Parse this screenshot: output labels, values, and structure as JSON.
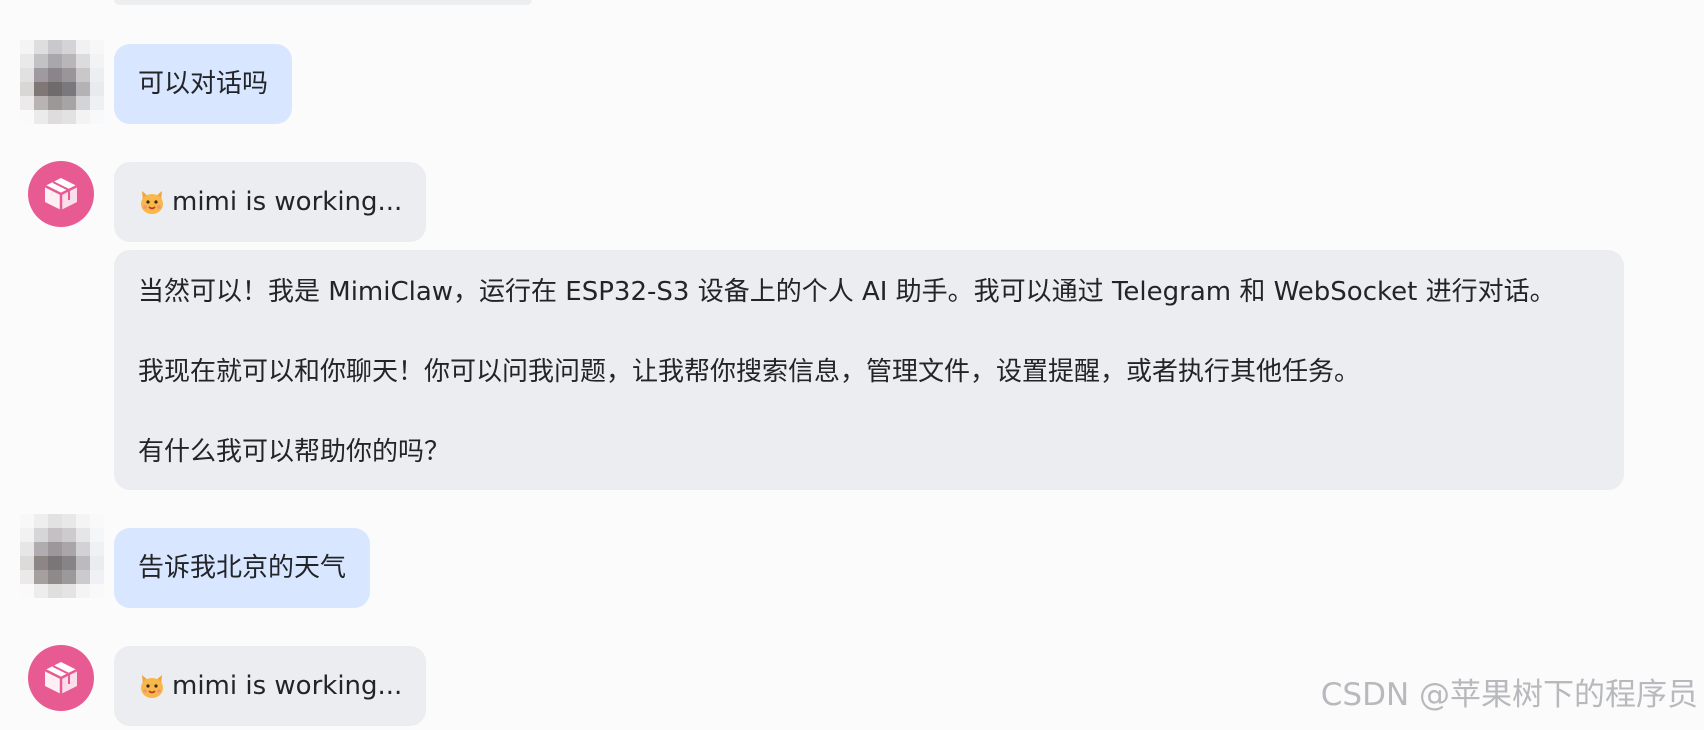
{
  "messages": [
    {
      "role": "user",
      "text": "可以对话吗"
    },
    {
      "role": "status",
      "icon": "cat-icon",
      "text": "mimi is working..."
    },
    {
      "role": "assistant",
      "paragraphs": [
        "当然可以！我是 MimiClaw，运行在 ESP32-S3 设备上的个人 AI 助手。我可以通过 Telegram 和 WebSocket 进行对话。",
        "我现在就可以和你聊天！你可以问我问题，让我帮你搜索信息，管理文件，设置提醒，或者执行其他任务。",
        "有什么我可以帮助你的吗？"
      ]
    },
    {
      "role": "user",
      "text": "告诉我北京的天气"
    },
    {
      "role": "status",
      "icon": "cat-icon",
      "text": "mimi is working..."
    }
  ],
  "watermark": "CSDN @苹果树下的程序员",
  "colors": {
    "user_bubble": "#d8e6ff",
    "bot_bubble": "#ecedf0",
    "bot_avatar": "#e85a92",
    "background": "#fbfbfc"
  }
}
